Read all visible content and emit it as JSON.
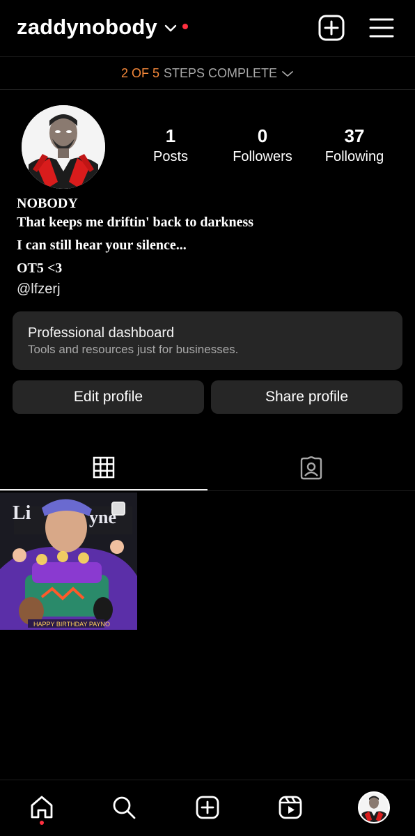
{
  "header": {
    "username": "zaddynobody",
    "notification_dot_color": "#ff3040"
  },
  "steps": {
    "progress": "2 OF 5",
    "label": "STEPS COMPLETE",
    "completed": 2,
    "total": 5,
    "accent_color": "#f5883a"
  },
  "stats": {
    "posts": {
      "value": "1",
      "label": "Posts"
    },
    "followers": {
      "value": "0",
      "label": "Followers"
    },
    "following": {
      "value": "37",
      "label": "Following"
    }
  },
  "bio": {
    "name": "NOBODY",
    "lines": [
      "That keeps me driftin' back to darkness",
      "I can still hear your silence...",
      "OT5 <3"
    ],
    "link": "@lfzerj"
  },
  "dashboard": {
    "title": "Professional dashboard",
    "subtitle": "Tools and resources just for businesses."
  },
  "buttons": {
    "edit": "Edit profile",
    "share": "Share profile"
  },
  "tabs": [
    {
      "name": "grid",
      "icon": "grid-icon",
      "active": true
    },
    {
      "name": "tagged",
      "icon": "tagged-icon",
      "active": false
    }
  ],
  "nav": {
    "items": [
      "home-icon",
      "search-icon",
      "create-icon",
      "reels-icon",
      "profile-avatar"
    ]
  }
}
